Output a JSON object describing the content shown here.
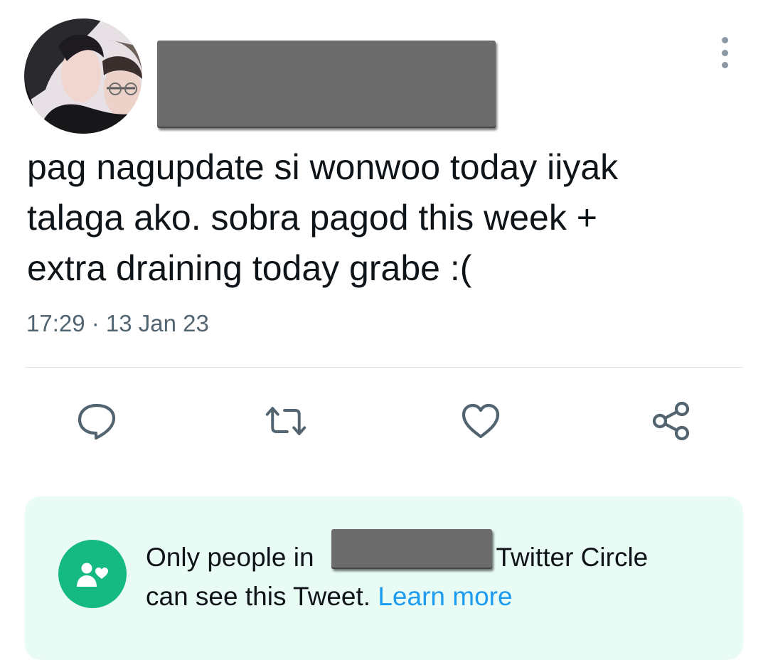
{
  "tweet": {
    "text_lines": [
      "pag nagupdate si wonwoo today iiyak",
      "talaga ako. sobra pagod this week +",
      "extra draining today grabe :("
    ],
    "timestamp": "17:29 · 13 Jan 23"
  },
  "actions": {
    "reply": {
      "icon": "reply-icon"
    },
    "retweet": {
      "icon": "retweet-icon"
    },
    "like": {
      "icon": "heart-icon"
    },
    "share": {
      "icon": "share-icon"
    }
  },
  "circle_notice": {
    "text_before": "Only people in ",
    "text_after": " Twitter Circle",
    "text_line2": "can see this Tweet. ",
    "learn_more": "Learn more",
    "icon": "twitter-circle-icon"
  },
  "colors": {
    "icon_gray": "#536471",
    "accent_blue": "#1d9bf0",
    "circle_green": "#15b982",
    "notice_bg": "#e9fbf5"
  }
}
